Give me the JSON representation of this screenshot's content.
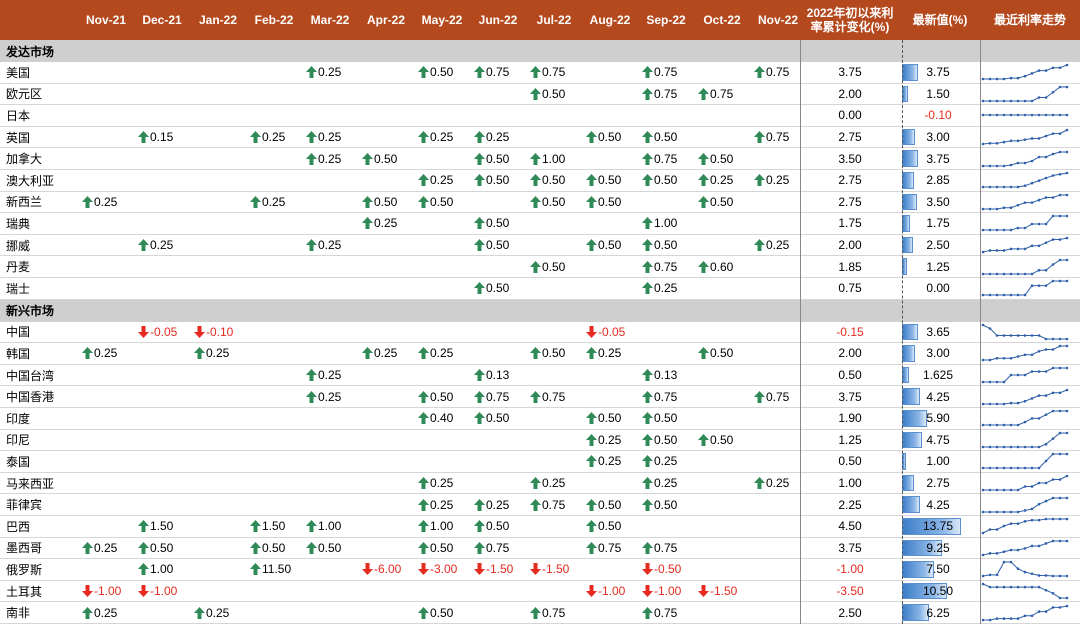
{
  "colors": {
    "header_bg": "#b4491e",
    "up_arrow": "#2e8b57",
    "down_arrow": "#e52a1f",
    "negative_text": "#e52a1f",
    "bar": "#3c7ec9",
    "section_bg": "#cfcfcf",
    "sparkline": "#2f5fa8"
  },
  "header": {
    "months": [
      "Nov-21",
      "Dec-21",
      "Jan-22",
      "Feb-22",
      "Mar-22",
      "Apr-22",
      "May-22",
      "Jun-22",
      "Jul-22",
      "Aug-22",
      "Sep-22",
      "Oct-22",
      "Nov-22"
    ],
    "ytd_line1": "2022年初以来利",
    "ytd_line2": "率累计变化(%)",
    "latest": "最新值(%)",
    "trend": "最近利率走势"
  },
  "sections": [
    {
      "title": "发达市场",
      "rows": [
        {
          "country": "美国",
          "moves": [
            "",
            "",
            "",
            "",
            "↑0.25",
            "",
            "↑0.50",
            "↑0.75",
            "↑0.75",
            "",
            "↑0.75",
            "",
            "↑0.75"
          ],
          "ytd": "3.75",
          "latest": "3.75",
          "latest_num": 3.75,
          "trend": [
            0.25,
            0.25,
            0.25,
            0.25,
            0.5,
            0.5,
            1.0,
            1.75,
            2.5,
            2.5,
            3.25,
            3.25,
            4.0
          ]
        },
        {
          "country": "欧元区",
          "moves": [
            "",
            "",
            "",
            "",
            "",
            "",
            "",
            "",
            "↑0.50",
            "",
            "↑0.75",
            "↑0.75",
            ""
          ],
          "ytd": "2.00",
          "latest": "1.50",
          "latest_num": 1.5,
          "trend": [
            -0.5,
            -0.5,
            -0.5,
            -0.5,
            -0.5,
            -0.5,
            -0.5,
            -0.5,
            0.0,
            0.0,
            0.75,
            1.5,
            1.5
          ]
        },
        {
          "country": "日本",
          "moves": [
            "",
            "",
            "",
            "",
            "",
            "",
            "",
            "",
            "",
            "",
            "",
            "",
            ""
          ],
          "ytd": "0.00",
          "latest": "-0.10",
          "latest_num": -0.1,
          "trend": [
            -0.1,
            -0.1,
            -0.1,
            -0.1,
            -0.1,
            -0.1,
            -0.1,
            -0.1,
            -0.1,
            -0.1,
            -0.1,
            -0.1,
            -0.1
          ]
        },
        {
          "country": "英国",
          "moves": [
            "",
            "↑0.15",
            "",
            "↑0.25",
            "↑0.25",
            "",
            "↑0.25",
            "↑0.25",
            "",
            "↑0.50",
            "↑0.50",
            "",
            "↑0.75"
          ],
          "ytd": "2.75",
          "latest": "3.00",
          "latest_num": 3.0,
          "trend": [
            0.1,
            0.25,
            0.25,
            0.5,
            0.75,
            0.75,
            1.0,
            1.25,
            1.25,
            1.75,
            2.25,
            2.25,
            3.0
          ]
        },
        {
          "country": "加拿大",
          "moves": [
            "",
            "",
            "",
            "",
            "↑0.25",
            "↑0.50",
            "",
            "↑0.50",
            "↑1.00",
            "",
            "↑0.75",
            "↑0.50",
            ""
          ],
          "ytd": "3.50",
          "latest": "3.75",
          "latest_num": 3.75,
          "trend": [
            0.25,
            0.25,
            0.25,
            0.25,
            0.5,
            1.0,
            1.0,
            1.5,
            2.5,
            2.5,
            3.25,
            3.75,
            3.75
          ]
        },
        {
          "country": "澳大利亚",
          "moves": [
            "",
            "",
            "",
            "",
            "",
            "",
            "↑0.25",
            "↑0.50",
            "↑0.50",
            "↑0.50",
            "↑0.50",
            "↑0.25",
            "↑0.25"
          ],
          "ytd": "2.75",
          "latest": "2.85",
          "latest_num": 2.85,
          "trend": [
            0.1,
            0.1,
            0.1,
            0.1,
            0.1,
            0.1,
            0.35,
            0.85,
            1.35,
            1.85,
            2.35,
            2.6,
            2.85
          ]
        },
        {
          "country": "新西兰",
          "moves": [
            "↑0.25",
            "",
            "",
            "↑0.25",
            "",
            "↑0.50",
            "↑0.50",
            "",
            "↑0.50",
            "↑0.50",
            "",
            "↑0.50",
            ""
          ],
          "ytd": "2.75",
          "latest": "3.50",
          "latest_num": 3.5,
          "trend": [
            0.75,
            0.75,
            0.75,
            1.0,
            1.0,
            1.5,
            2.0,
            2.0,
            2.5,
            3.0,
            3.0,
            3.5,
            3.5
          ]
        },
        {
          "country": "瑞典",
          "moves": [
            "",
            "",
            "",
            "",
            "",
            "↑0.25",
            "",
            "↑0.50",
            "",
            "",
            "↑1.00",
            "",
            ""
          ],
          "ytd": "1.75",
          "latest": "1.75",
          "latest_num": 1.75,
          "trend": [
            0.0,
            0.0,
            0.0,
            0.0,
            0.0,
            0.25,
            0.25,
            0.75,
            0.75,
            0.75,
            1.75,
            1.75,
            1.75
          ]
        },
        {
          "country": "挪威",
          "moves": [
            "",
            "↑0.25",
            "",
            "",
            "↑0.25",
            "",
            "",
            "↑0.50",
            "",
            "↑0.50",
            "↑0.50",
            "",
            "↑0.25"
          ],
          "ytd": "2.00",
          "latest": "2.50",
          "latest_num": 2.5,
          "trend": [
            0.25,
            0.5,
            0.5,
            0.5,
            0.75,
            0.75,
            0.75,
            1.25,
            1.25,
            1.75,
            2.25,
            2.25,
            2.5
          ]
        },
        {
          "country": "丹麦",
          "moves": [
            "",
            "",
            "",
            "",
            "",
            "",
            "",
            "",
            "↑0.50",
            "",
            "↑0.75",
            "↑0.60",
            ""
          ],
          "ytd": "1.85",
          "latest": "1.25",
          "latest_num": 1.25,
          "trend": [
            -0.6,
            -0.6,
            -0.6,
            -0.6,
            -0.6,
            -0.6,
            -0.6,
            -0.6,
            -0.1,
            -0.1,
            0.65,
            1.25,
            1.25
          ]
        },
        {
          "country": "瑞士",
          "moves": [
            "",
            "",
            "",
            "",
            "",
            "",
            "",
            "↑0.50",
            "",
            "",
            "↑0.25",
            "",
            ""
          ],
          "ytd": "0.75",
          "latest": "0.00",
          "latest_num": 0.0,
          "trend": [
            -0.75,
            -0.75,
            -0.75,
            -0.75,
            -0.75,
            -0.75,
            -0.75,
            -0.25,
            -0.25,
            -0.25,
            0.0,
            0.0,
            0.0
          ]
        }
      ]
    },
    {
      "title": "新兴市场",
      "rows": [
        {
          "country": "中国",
          "moves": [
            "",
            "↓-0.05",
            "↓-0.10",
            "",
            "",
            "",
            "",
            "",
            "",
            "↓-0.05",
            "",
            "",
            ""
          ],
          "ytd": "-0.15",
          "latest": "3.65",
          "latest_num": 3.65,
          "trend": [
            3.85,
            3.8,
            3.7,
            3.7,
            3.7,
            3.7,
            3.7,
            3.7,
            3.7,
            3.65,
            3.65,
            3.65,
            3.65
          ]
        },
        {
          "country": "韩国",
          "moves": [
            "↑0.25",
            "",
            "↑0.25",
            "",
            "",
            "↑0.25",
            "↑0.25",
            "",
            "↑0.50",
            "↑0.25",
            "",
            "↑0.50",
            ""
          ],
          "ytd": "2.00",
          "latest": "3.00",
          "latest_num": 3.0,
          "trend": [
            1.0,
            1.0,
            1.25,
            1.25,
            1.25,
            1.5,
            1.75,
            1.75,
            2.25,
            2.5,
            2.5,
            3.0,
            3.0
          ]
        },
        {
          "country": "中国台湾",
          "moves": [
            "",
            "",
            "",
            "",
            "↑0.25",
            "",
            "",
            "↑0.13",
            "",
            "",
            "↑0.13",
            "",
            ""
          ],
          "ytd": "0.50",
          "latest": "1.625",
          "latest_num": 1.625,
          "trend": [
            1.125,
            1.125,
            1.125,
            1.125,
            1.375,
            1.375,
            1.375,
            1.5,
            1.5,
            1.5,
            1.625,
            1.625,
            1.625
          ]
        },
        {
          "country": "中国香港",
          "moves": [
            "",
            "",
            "",
            "",
            "↑0.25",
            "",
            "↑0.50",
            "↑0.75",
            "↑0.75",
            "",
            "↑0.75",
            "",
            "↑0.75"
          ],
          "ytd": "3.75",
          "latest": "4.25",
          "latest_num": 4.25,
          "trend": [
            0.5,
            0.5,
            0.5,
            0.5,
            0.75,
            0.75,
            1.25,
            2.0,
            2.75,
            2.75,
            3.5,
            3.5,
            4.25
          ]
        },
        {
          "country": "印度",
          "moves": [
            "",
            "",
            "",
            "",
            "",
            "",
            "↑0.40",
            "↑0.50",
            "",
            "↑0.50",
            "↑0.50",
            "",
            ""
          ],
          "ytd": "1.90",
          "latest": "5.90",
          "latest_num": 5.9,
          "trend": [
            4.0,
            4.0,
            4.0,
            4.0,
            4.0,
            4.0,
            4.4,
            4.9,
            4.9,
            5.4,
            5.9,
            5.9,
            5.9
          ]
        },
        {
          "country": "印尼",
          "moves": [
            "",
            "",
            "",
            "",
            "",
            "",
            "",
            "",
            "",
            "↑0.25",
            "↑0.50",
            "↑0.50",
            ""
          ],
          "ytd": "1.25",
          "latest": "4.75",
          "latest_num": 4.75,
          "trend": [
            3.5,
            3.5,
            3.5,
            3.5,
            3.5,
            3.5,
            3.5,
            3.5,
            3.5,
            3.75,
            4.25,
            4.75,
            4.75
          ]
        },
        {
          "country": "泰国",
          "moves": [
            "",
            "",
            "",
            "",
            "",
            "",
            "",
            "",
            "",
            "↑0.25",
            "↑0.25",
            "",
            ""
          ],
          "ytd": "0.50",
          "latest": "1.00",
          "latest_num": 1.0,
          "trend": [
            0.5,
            0.5,
            0.5,
            0.5,
            0.5,
            0.5,
            0.5,
            0.5,
            0.5,
            0.75,
            1.0,
            1.0,
            1.0
          ]
        },
        {
          "country": "马来西亚",
          "moves": [
            "",
            "",
            "",
            "",
            "",
            "",
            "↑0.25",
            "",
            "↑0.25",
            "",
            "↑0.25",
            "",
            "↑0.25"
          ],
          "ytd": "1.00",
          "latest": "2.75",
          "latest_num": 2.75,
          "trend": [
            1.75,
            1.75,
            1.75,
            1.75,
            1.75,
            1.75,
            2.0,
            2.0,
            2.25,
            2.25,
            2.5,
            2.5,
            2.75
          ]
        },
        {
          "country": "菲律宾",
          "moves": [
            "",
            "",
            "",
            "",
            "",
            "",
            "↑0.25",
            "↑0.25",
            "↑0.75",
            "↑0.50",
            "↑0.50",
            "",
            ""
          ],
          "ytd": "2.25",
          "latest": "4.25",
          "latest_num": 4.25,
          "trend": [
            2.0,
            2.0,
            2.0,
            2.0,
            2.0,
            2.0,
            2.25,
            2.5,
            3.25,
            3.75,
            4.25,
            4.25,
            4.25
          ]
        },
        {
          "country": "巴西",
          "moves": [
            "",
            "↑1.50",
            "",
            "↑1.50",
            "↑1.00",
            "",
            "↑1.00",
            "↑0.50",
            "",
            "↑0.50",
            "",
            "",
            ""
          ],
          "ytd": "4.50",
          "latest": "13.75",
          "latest_num": 13.75,
          "trend": [
            7.75,
            9.25,
            9.25,
            10.75,
            11.75,
            11.75,
            12.75,
            13.25,
            13.25,
            13.75,
            13.75,
            13.75,
            13.75
          ]
        },
        {
          "country": "墨西哥",
          "moves": [
            "↑0.25",
            "↑0.50",
            "",
            "↑0.50",
            "↑0.50",
            "",
            "↑0.50",
            "↑0.75",
            "",
            "↑0.75",
            "↑0.75",
            "",
            ""
          ],
          "ytd": "3.75",
          "latest": "9.25",
          "latest_num": 9.25,
          "trend": [
            5.0,
            5.5,
            5.5,
            6.0,
            6.5,
            6.5,
            7.0,
            7.75,
            7.75,
            8.5,
            9.25,
            9.25,
            9.25
          ]
        },
        {
          "country": "俄罗斯",
          "moves": [
            "",
            "↑1.00",
            "",
            "↑11.50",
            "",
            "↓-6.00",
            "↓-3.00",
            "↓-1.50",
            "↓-1.50",
            "",
            "↓-0.50",
            "",
            ""
          ],
          "ytd": "-1.00",
          "latest": "7.50",
          "latest_num": 7.5,
          "trend": [
            7.5,
            8.5,
            8.5,
            20.0,
            20.0,
            14.0,
            11.0,
            9.5,
            8.0,
            8.0,
            7.5,
            7.5,
            7.5
          ]
        },
        {
          "country": "土耳其",
          "moves": [
            "↓-1.00",
            "↓-1.00",
            "",
            "",
            "",
            "",
            "",
            "",
            "",
            "↓-1.00",
            "↓-1.00",
            "↓-1.50",
            ""
          ],
          "ytd": "-3.50",
          "latest": "10.50",
          "latest_num": 10.5,
          "trend": [
            15.0,
            14.0,
            14.0,
            14.0,
            14.0,
            14.0,
            14.0,
            14.0,
            14.0,
            13.0,
            12.0,
            10.5,
            10.5
          ]
        },
        {
          "country": "南非",
          "moves": [
            "↑0.25",
            "",
            "↑0.25",
            "",
            "",
            "",
            "↑0.50",
            "",
            "↑0.75",
            "",
            "↑0.75",
            "",
            ""
          ],
          "ytd": "2.50",
          "latest": "6.25",
          "latest_num": 6.25,
          "trend": [
            3.75,
            3.75,
            4.0,
            4.0,
            4.0,
            4.0,
            4.5,
            4.5,
            5.25,
            5.25,
            6.0,
            6.0,
            6.25
          ]
        }
      ]
    }
  ]
}
